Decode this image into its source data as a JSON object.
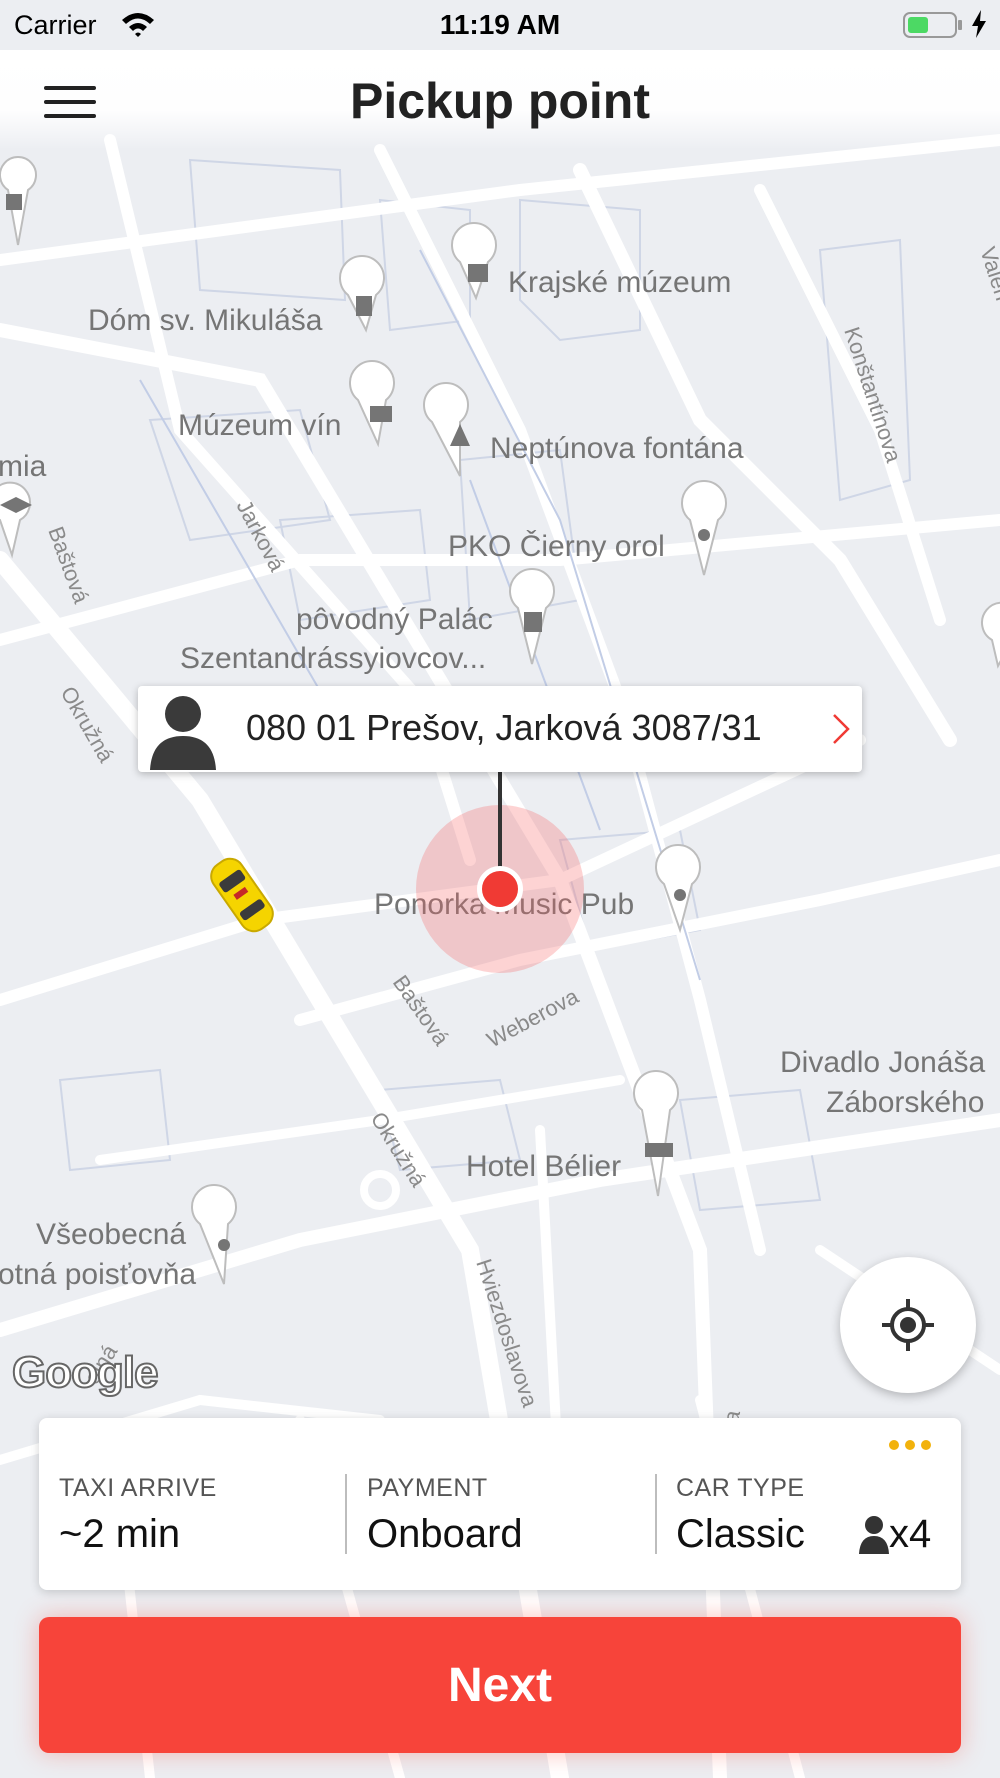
{
  "status_bar": {
    "carrier": "Carrier",
    "time": "11:19 AM"
  },
  "header": {
    "title": "Pickup point",
    "menu_icon": "hamburger-menu-icon"
  },
  "map": {
    "places": [
      {
        "id": "krajske",
        "name": "Krajské múzeum",
        "icon": "museum-icon"
      },
      {
        "id": "dom",
        "name": "Dóm sv. Mikuláša",
        "icon": "church-icon"
      },
      {
        "id": "muzeum-vin",
        "name": "Múzeum vín",
        "icon": "camera-icon"
      },
      {
        "id": "neptun",
        "name": "Neptúnova fontána",
        "icon": "tree-icon"
      },
      {
        "id": "pko",
        "name": "PKO Čierny orol",
        "icon": "pin-icon"
      },
      {
        "id": "palac1",
        "name": "pôvodný Palác",
        "icon": "castle-icon"
      },
      {
        "id": "palac2",
        "name": "Szentandrássyiovcov...",
        "icon": ""
      },
      {
        "id": "ponorka",
        "name": "Ponorka Music Pub",
        "icon": "pin-icon"
      },
      {
        "id": "divadlo1",
        "name": "Divadlo Jonáša",
        "icon": "pin-icon"
      },
      {
        "id": "divadlo2",
        "name": "Záborského",
        "icon": ""
      },
      {
        "id": "belier",
        "name": "Hotel Bélier",
        "icon": "hotel-icon"
      },
      {
        "id": "vseob1",
        "name": "Všeobecná",
        "icon": "pin-icon"
      },
      {
        "id": "vseob2",
        "name": "otná poisťovňa",
        "icon": ""
      },
      {
        "id": "mia",
        "name": "mia",
        "icon": "school-icon"
      }
    ],
    "streets": [
      "Baštová",
      "Jarková",
      "Okružná",
      "Baštová",
      "Weberova",
      "Okružná",
      "Hviezdoslavova",
      "Konštantínova",
      "Valen",
      "olná",
      "a"
    ],
    "attribution": "Google"
  },
  "pickup": {
    "address": "080 01 Prešov, Jarková 3087/31"
  },
  "trip_info": {
    "taxi_arrive": {
      "label": "TAXI ARRIVE",
      "value": "~2 min"
    },
    "payment": {
      "label": "PAYMENT",
      "value": "Onboard"
    },
    "car_type": {
      "label": "CAR TYPE",
      "value": "Classic",
      "seats": "x4"
    },
    "more_icon": "more-dots-icon"
  },
  "actions": {
    "next_label": "Next"
  },
  "colors": {
    "accent": "#f7443a",
    "pin": "#f03a34",
    "taxi": "#f5d400",
    "more_dots": "#f2b20c",
    "map_bg": "#eceef2"
  }
}
